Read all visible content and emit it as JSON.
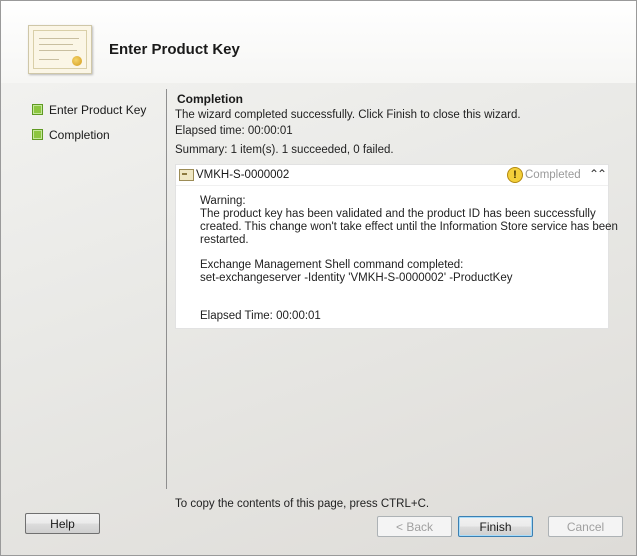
{
  "header": {
    "title": "Enter Product Key",
    "icon": "certificate-icon"
  },
  "steps": [
    {
      "label": "Enter Product Key",
      "icon": "step-complete-icon",
      "color": "#8cc63f"
    },
    {
      "label": "Completion",
      "icon": "step-complete-icon",
      "color": "#8cc63f"
    }
  ],
  "completion": {
    "title": "Completion",
    "message": "The wizard completed successfully. Click Finish to close this wizard.",
    "elapsed": "Elapsed time: 00:00:01",
    "summary": "Summary: 1 item(s). 1 succeeded, 0 failed."
  },
  "result": {
    "server": "VMKH-S-0000002",
    "status": "Completed",
    "status_icon": "warning-icon",
    "details": [
      "Warning:",
      "The product key has been validated and the product ID has been successfully",
      "created. This change won't take effect until the Information Store service has been",
      "restarted.",
      "Exchange Management Shell command completed:",
      "set-exchangeserver -Identity 'VMKH-S-0000002' -ProductKey",
      "Elapsed Time: 00:00:01"
    ]
  },
  "footer": {
    "note": "To copy the contents of this page, press CTRL+C."
  },
  "buttons": {
    "help": "Help",
    "back": "< Back",
    "finish": "Finish",
    "cancel": "Cancel"
  }
}
